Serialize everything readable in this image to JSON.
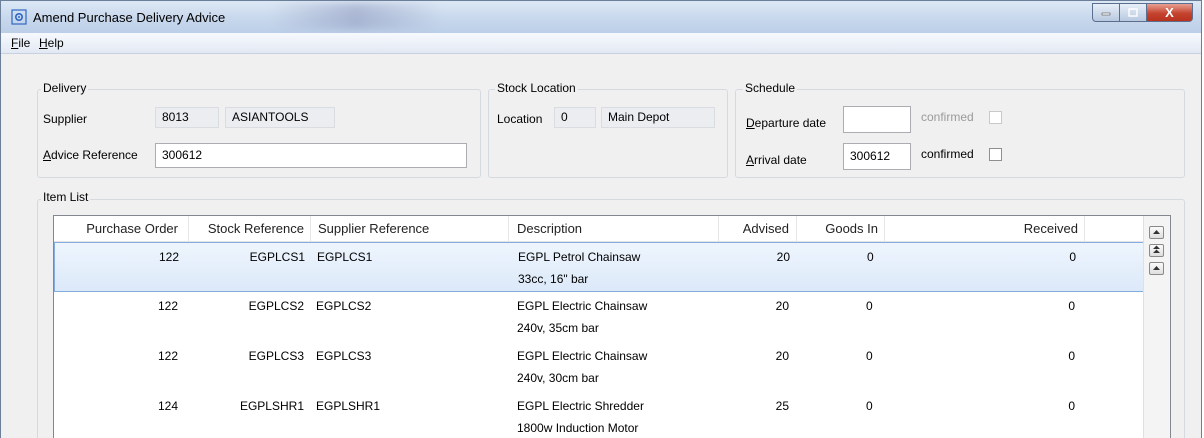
{
  "window": {
    "title": "Amend Purchase Delivery Advice",
    "close_glyph": "X"
  },
  "menu": [
    {
      "label": "File",
      "accel": "F",
      "rest": "ile"
    },
    {
      "label": "Help",
      "accel": "H",
      "rest": "elp"
    }
  ],
  "delivery": {
    "group_label": "Delivery",
    "supplier_label": "Supplier",
    "supplier_code": "8013",
    "supplier_name": "ASIANTOOLS",
    "advice_label_accel": "A",
    "advice_label_rest": "dvice Reference",
    "advice_reference": "300612"
  },
  "stock_location": {
    "group_label": "Stock Location",
    "location_label": "Location",
    "location_code": "0",
    "location_name": "Main Depot"
  },
  "schedule": {
    "group_label": "Schedule",
    "departure_label_accel": "D",
    "departure_label_rest": "eparture date",
    "departure_value": "",
    "departure_confirmed_label": "confirmed",
    "arrival_label_accel": "A",
    "arrival_label_rest": "rrival date",
    "arrival_value": "300612",
    "arrival_confirmed_label": "confirmed"
  },
  "item_list": {
    "group_label": "Item List",
    "columns": [
      "Purchase Order",
      "Stock Reference",
      "Supplier Reference",
      "Description",
      "Advised",
      "Goods In",
      "Received"
    ],
    "rows": [
      {
        "po": "122",
        "stock_ref": "EGPLCS1",
        "supplier_ref": "EGPLCS1",
        "desc1": "EGPL Petrol Chainsaw",
        "desc2": "33cc, 16\" bar",
        "advised": "20",
        "goods_in": "0",
        "received": "0",
        "selected": true
      },
      {
        "po": "122",
        "stock_ref": "EGPLCS2",
        "supplier_ref": "EGPLCS2",
        "desc1": "EGPL Electric Chainsaw",
        "desc2": "240v, 35cm bar",
        "advised": "20",
        "goods_in": "0",
        "received": "0",
        "selected": false
      },
      {
        "po": "122",
        "stock_ref": "EGPLCS3",
        "supplier_ref": "EGPLCS3",
        "desc1": "EGPL Electric Chainsaw",
        "desc2": "240v, 30cm bar",
        "advised": "20",
        "goods_in": "0",
        "received": "0",
        "selected": false
      },
      {
        "po": "124",
        "stock_ref": "EGPLSHR1",
        "supplier_ref": "EGPLSHR1",
        "desc1": "EGPL Electric Shredder",
        "desc2": "1800w Induction Motor",
        "advised": "25",
        "goods_in": "0",
        "received": "0",
        "selected": false
      }
    ]
  },
  "icons": {
    "app": "app-gear-icon",
    "minimize": "minimize-icon",
    "maximize": "maximize-icon",
    "close": "close-icon",
    "scroll_up": "scroll-up-icon",
    "scroll_top": "scroll-top-icon",
    "scroll_up_small": "scroll-up-small-icon"
  },
  "colors": {
    "selection": "#dce9f9",
    "selection_border": "#84acdd",
    "close_button": "#c5442f"
  }
}
